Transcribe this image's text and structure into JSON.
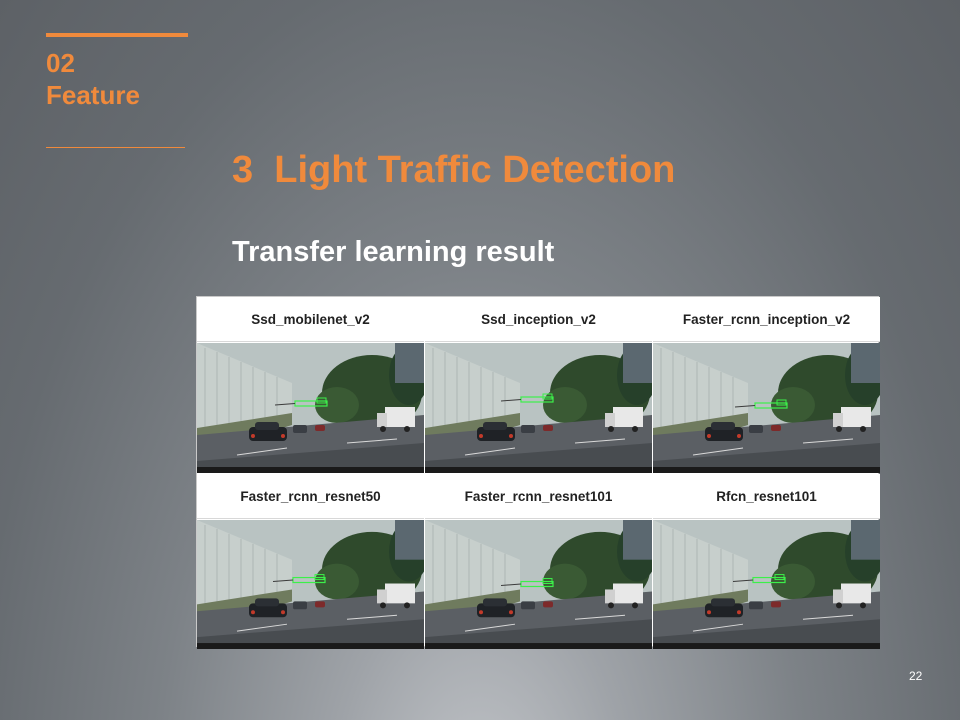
{
  "section": {
    "number": "02",
    "label": "Feature"
  },
  "slide": {
    "title": "3  Light Traffic Detection",
    "subtitle": "Transfer learning result",
    "page_number": "22"
  },
  "models": [
    {
      "name": "Ssd_mobilenet_v2"
    },
    {
      "name": "Ssd_inception_v2"
    },
    {
      "name": "Faster_rcnn_inception_v2"
    },
    {
      "name": "Faster_rcnn_resnet50"
    },
    {
      "name": "Faster_rcnn_resnet101"
    },
    {
      "name": "Rfcn_resnet101"
    }
  ],
  "colors": {
    "accent": "#f08a3c",
    "detection_box": "#3cf04a",
    "text": "#ffffff"
  }
}
